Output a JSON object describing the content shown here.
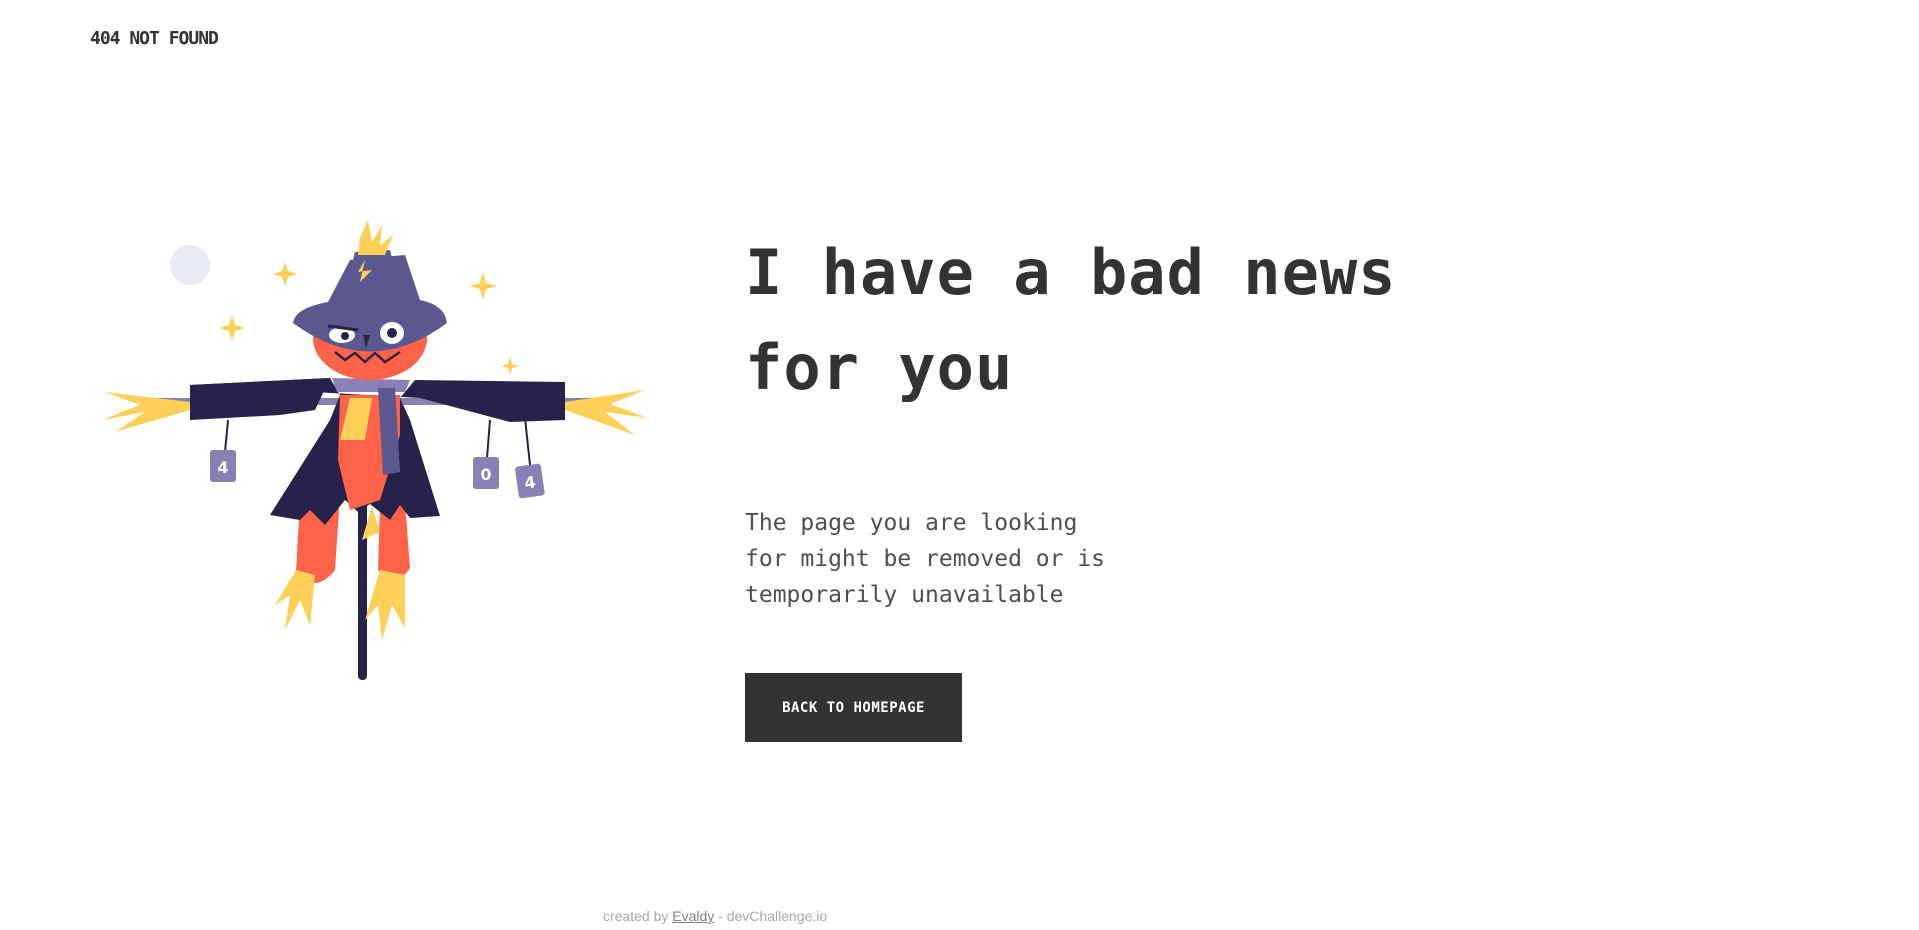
{
  "header": {
    "brand": "404 NOT FOUND"
  },
  "main": {
    "headline": "I have a bad news for you",
    "message": "The page you are looking for might be removed or is temporarily unavailable",
    "cta_label": "BACK TO HOMEPAGE"
  },
  "illustration": {
    "icon": "scarecrow-icon",
    "can_digits": [
      "4",
      "0",
      "4"
    ]
  },
  "footer": {
    "prefix": "created by",
    "author": "Evaldy",
    "suffix": "- devChallenge.io"
  },
  "colors": {
    "text": "#333333",
    "body_text": "#4f4f4f",
    "button_bg": "#333333",
    "button_text": "#ffffff",
    "hat": "#5b5890",
    "coat": "#27224b",
    "face": "#fe6347",
    "straw": "#ffd057",
    "can": "#8a80b6",
    "moon": "#e8eaf6"
  }
}
